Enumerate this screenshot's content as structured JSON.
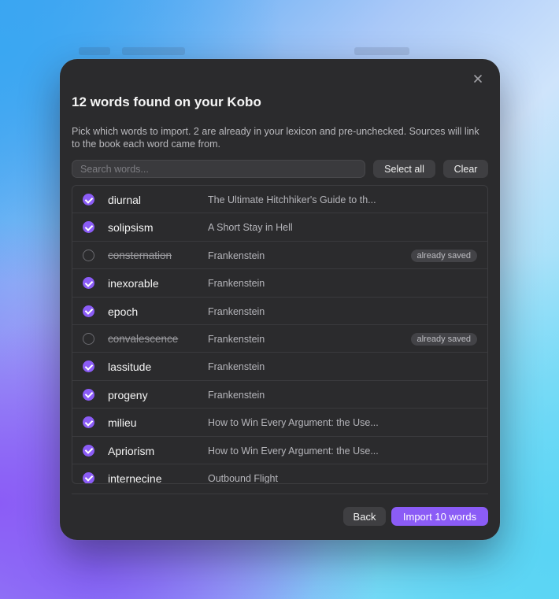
{
  "dialog": {
    "title": "12 words found on your Kobo",
    "description": "Pick which words to import. 2 are already in your lexicon and pre-unchecked. Sources will link to the book each word came from.",
    "search_placeholder": "Search words...",
    "select_all_label": "Select all",
    "clear_label": "Clear",
    "back_label": "Back",
    "import_label": "Import 10 words",
    "close_icon": "close-icon"
  },
  "words": [
    {
      "word": "diurnal",
      "source": "The Ultimate Hitchhiker's Guide to th...",
      "checked": true,
      "saved": false,
      "badge": ""
    },
    {
      "word": "solipsism",
      "source": "A Short Stay in Hell",
      "checked": true,
      "saved": false,
      "badge": ""
    },
    {
      "word": "consternation",
      "source": "Frankenstein",
      "checked": false,
      "saved": true,
      "badge": "already saved"
    },
    {
      "word": "inexorable",
      "source": "Frankenstein",
      "checked": true,
      "saved": false,
      "badge": ""
    },
    {
      "word": "epoch",
      "source": "Frankenstein",
      "checked": true,
      "saved": false,
      "badge": ""
    },
    {
      "word": "convalescence",
      "source": "Frankenstein",
      "checked": false,
      "saved": true,
      "badge": "already saved"
    },
    {
      "word": "lassitude",
      "source": "Frankenstein",
      "checked": true,
      "saved": false,
      "badge": ""
    },
    {
      "word": "progeny",
      "source": "Frankenstein",
      "checked": true,
      "saved": false,
      "badge": ""
    },
    {
      "word": "milieu",
      "source": "How to Win Every Argument: the Use...",
      "checked": true,
      "saved": false,
      "badge": ""
    },
    {
      "word": "Apriorism",
      "source": "How to Win Every Argument: the Use...",
      "checked": true,
      "saved": false,
      "badge": ""
    },
    {
      "word": "internecine",
      "source": "Outbound Flight",
      "checked": true,
      "saved": false,
      "badge": ""
    }
  ],
  "colors": {
    "accent": "#8b5cf6",
    "dialog_bg": "#2b2b2d"
  }
}
